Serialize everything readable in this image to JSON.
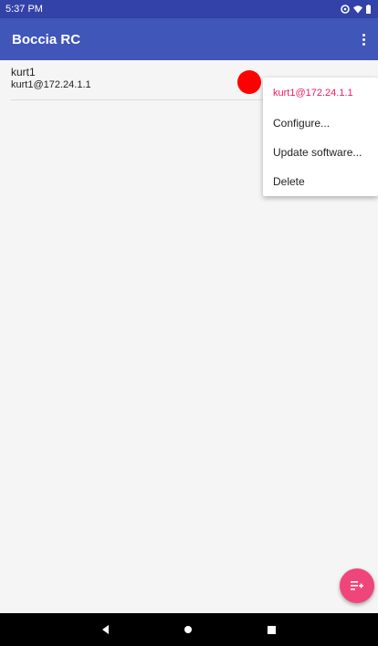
{
  "status_bar": {
    "time": "5:37 PM"
  },
  "app_bar": {
    "title": "Boccia RC"
  },
  "devices": [
    {
      "name": "kurt1",
      "address": "kurt1@172.24.1.1",
      "status_color": "#ff0000"
    }
  ],
  "popup_menu": {
    "header": "kurt1@172.24.1.1",
    "items": [
      "Configure...",
      "Update software...",
      "Delete"
    ]
  },
  "colors": {
    "primary": "#4056b8",
    "primary_dark": "#3242a8",
    "accent": "#f0457a"
  },
  "icons": {
    "overflow": "more-vert-icon",
    "fab": "playlist-add-icon",
    "nav": [
      "back-icon",
      "home-icon",
      "recents-icon"
    ]
  }
}
